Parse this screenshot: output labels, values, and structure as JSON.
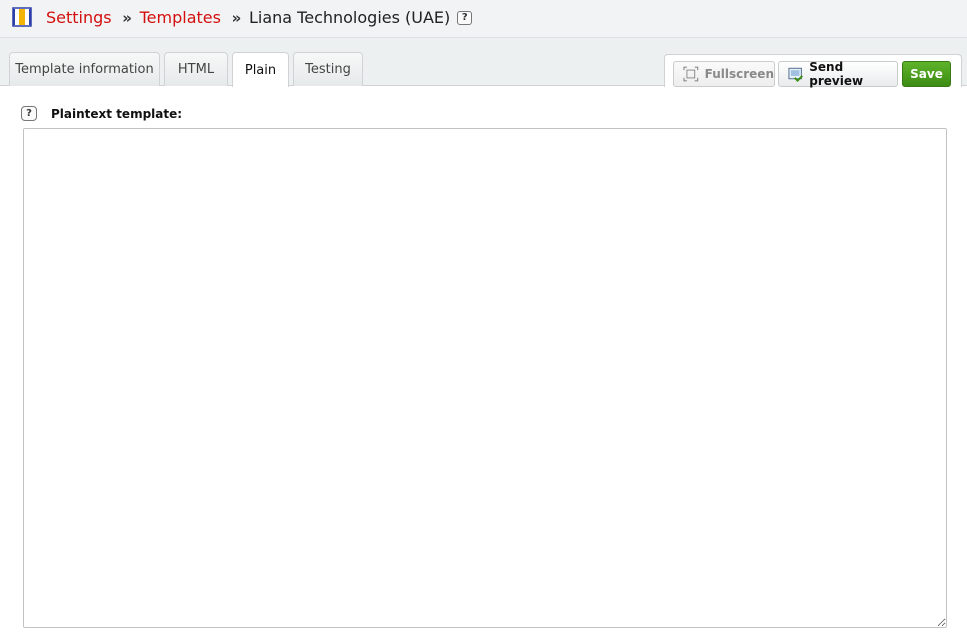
{
  "breadcrumb": {
    "items": [
      "Settings",
      "Templates"
    ],
    "separator": "»",
    "current": "Liana Technologies (UAE)",
    "help_label": "?"
  },
  "tabs": [
    {
      "label": "Template information",
      "active": false
    },
    {
      "label": "HTML",
      "active": false
    },
    {
      "label": "Plain",
      "active": true
    },
    {
      "label": "Testing",
      "active": false
    }
  ],
  "actions": {
    "fullscreen_label": "Fullscreen",
    "send_preview_label": "Send preview",
    "save_label": "Save"
  },
  "editor": {
    "help_label": "?",
    "label": "Plaintext template:",
    "value": ""
  },
  "colors": {
    "link": "#d40f0f",
    "save_button": "#4a9e1d",
    "header_bg": "#f1f3f4"
  },
  "icons": {
    "app": "templates-app-icon",
    "fullscreen": "fullscreen-icon",
    "send_preview": "send-preview-icon"
  }
}
